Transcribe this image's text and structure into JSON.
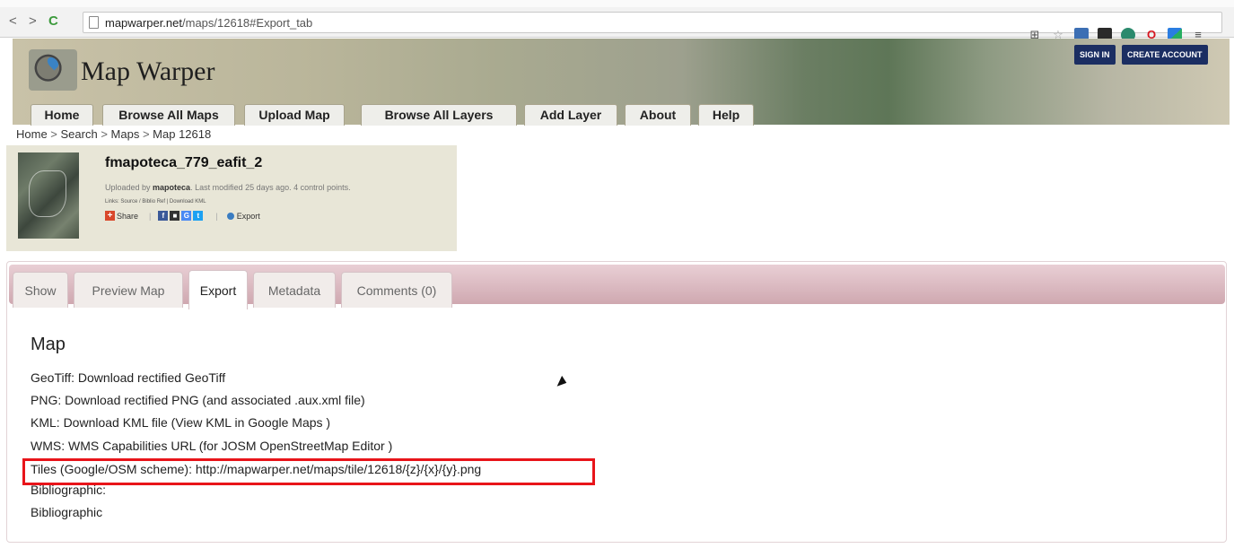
{
  "browser": {
    "back_icon": "<",
    "forward_icon": ">",
    "reload_icon": "C",
    "url_host": "mapwarper.net",
    "url_path": "/maps/12618#Export_tab",
    "extension_icons": [
      "translate-icon",
      "star-icon",
      "extension-icon",
      "extension-icon",
      "extension-icon",
      "opera-icon",
      "extension-icon",
      "menu-icon"
    ]
  },
  "header": {
    "site_title": "Map Warper",
    "sign_in": "SIGN IN",
    "create_account": "CREATE ACCOUNT",
    "menu": [
      "Home",
      "Browse All Maps",
      "Upload Map",
      "Browse All Layers",
      "Add Layer",
      "About",
      "Help"
    ]
  },
  "breadcrumb": [
    "Home",
    "Search",
    "Maps",
    "Map 12618"
  ],
  "map": {
    "title": "fmapoteca_779_eafit_2",
    "uploaded_prefix": "Uploaded by ",
    "uploader": "mapoteca",
    "uploaded_suffix": ". Last modified 25 days ago. 4 control points.",
    "links": "Links: Source / Biblio Ref | Download KML",
    "share": "Share",
    "export": "Export"
  },
  "tabs": [
    "Show",
    "Preview Map",
    "Export",
    "Metadata",
    "Comments (0)"
  ],
  "active_tab": "Export",
  "export_section": {
    "title": "Map",
    "lines": [
      "GeoTiff: Download rectified GeoTiff",
      "PNG: Download rectified PNG (and associated .aux.xml file)",
      "KML: Download KML file (View KML in Google Maps )",
      "WMS: WMS Capabilities URL (for JOSM OpenStreetMap Editor )",
      "Tiles (Google/OSM scheme): http://mapwarper.net/maps/tile/12618/{z}/{x}/{y}.png",
      "Bibliographic:",
      "Bibliographic"
    ]
  },
  "colors": {
    "highlight_border": "#e8141a",
    "auth_button": "#1b2e62",
    "tab_strip": "#cfa8b0",
    "summary_bg": "#e8e6d7"
  }
}
